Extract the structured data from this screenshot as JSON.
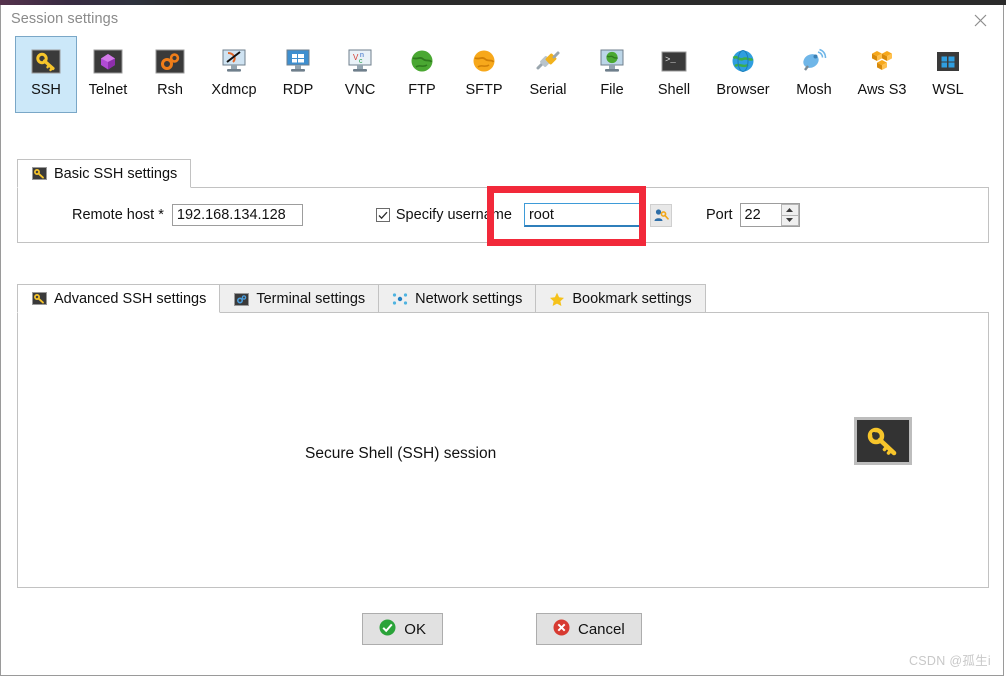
{
  "window": {
    "title": "Session settings",
    "close_icon": "close-icon"
  },
  "session_types": [
    {
      "label": "SSH",
      "icon": "ssh-key-icon",
      "selected": true
    },
    {
      "label": "Telnet",
      "icon": "telnet-cube-icon",
      "selected": false
    },
    {
      "label": "Rsh",
      "icon": "rsh-gears-icon",
      "selected": false
    },
    {
      "label": "Xdmcp",
      "icon": "xdmcp-monitor-icon",
      "selected": false
    },
    {
      "label": "RDP",
      "icon": "rdp-monitor-icon",
      "selected": false
    },
    {
      "label": "VNC",
      "icon": "vnc-monitor-icon",
      "selected": false
    },
    {
      "label": "FTP",
      "icon": "ftp-globe-icon",
      "selected": false
    },
    {
      "label": "SFTP",
      "icon": "sftp-globe-icon",
      "selected": false
    },
    {
      "label": "Serial",
      "icon": "serial-plug-icon",
      "selected": false
    },
    {
      "label": "File",
      "icon": "file-monitor-icon",
      "selected": false
    },
    {
      "label": "Shell",
      "icon": "shell-prompt-icon",
      "selected": false
    },
    {
      "label": "Browser",
      "icon": "browser-globe-icon",
      "selected": false
    },
    {
      "label": "Mosh",
      "icon": "mosh-dish-icon",
      "selected": false
    },
    {
      "label": "Aws S3",
      "icon": "aws-s3-cubes-icon",
      "selected": false
    },
    {
      "label": "WSL",
      "icon": "wsl-windows-icon",
      "selected": false
    }
  ],
  "basic_panel": {
    "tab_label": "Basic SSH settings",
    "tab_icon": "ssh-key-icon",
    "remote_host_label": "Remote host *",
    "remote_host_value": "192.168.134.128",
    "remote_host_placeholder": "",
    "specify_username_label": "Specify username",
    "specify_username_checked": true,
    "username_value": "root",
    "username_placeholder": "",
    "username_key_button_icon": "user-key-icon",
    "port_label": "Port",
    "port_value": "22",
    "spin_up_icon": "chevron-up-icon",
    "spin_down_icon": "chevron-down-icon"
  },
  "secondary_tabs": [
    {
      "label": "Advanced SSH settings",
      "icon": "ssh-key-icon",
      "active": true
    },
    {
      "label": "Terminal settings",
      "icon": "terminal-gear-icon",
      "active": false
    },
    {
      "label": "Network settings",
      "icon": "network-dots-icon",
      "active": false
    },
    {
      "label": "Bookmark settings",
      "icon": "star-icon",
      "active": false
    }
  ],
  "session_panel": {
    "caption": "Secure Shell (SSH) session",
    "badge_icon": "ssh-key-icon"
  },
  "buttons": {
    "ok_label": "OK",
    "ok_icon": "check-circle-icon",
    "cancel_label": "Cancel",
    "cancel_icon": "x-circle-icon"
  },
  "watermark": "CSDN @孤生i",
  "colors": {
    "selected_tab_bg": "#cce8f9",
    "selected_tab_border": "#7aa7c7",
    "focus_border": "#3e9bd8",
    "annotation_red": "#f2293a",
    "ok_green": "#2aa339",
    "cancel_red": "#d73a31",
    "key_yellow": "#f7c52b"
  }
}
